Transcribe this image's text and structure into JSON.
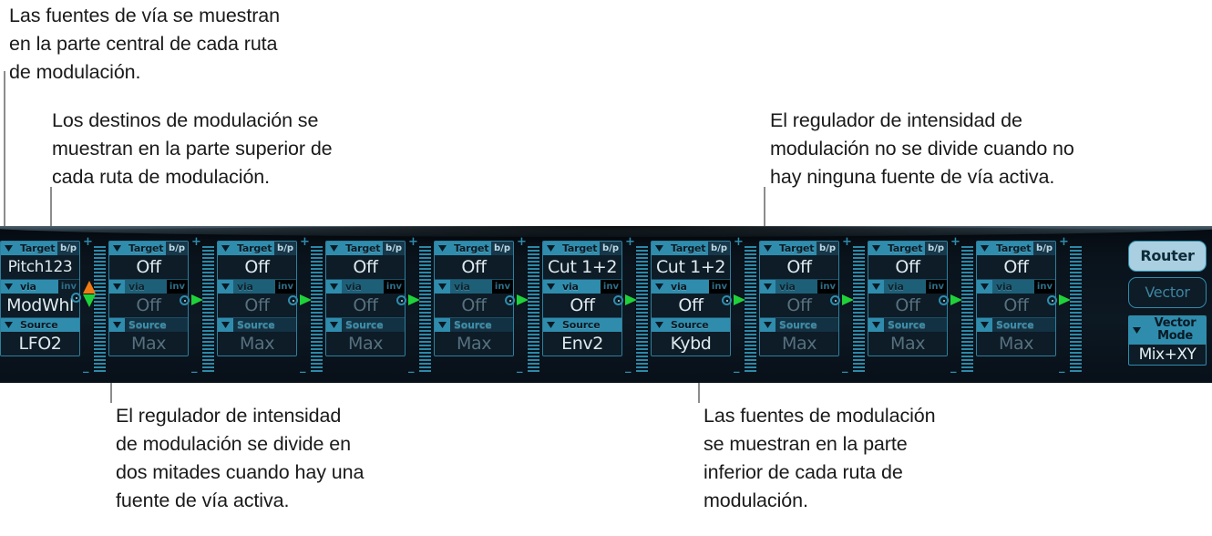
{
  "annotations": {
    "via_sources": "Las fuentes de vía se muestran\nen la parte central de cada ruta\nde modulación.",
    "targets": "Los destinos de modulación se\nmuestran en la parte superior de\ncada ruta de modulación.",
    "intensity_undivided": "El regulador de intensidad de\nmodulación no se divide cuando no\nhay ninguna fuente de vía activa.",
    "intensity_divided": "El regulador de intensidad\nde modulación se divide en\ndos mitades cuando hay una\nfuente de vía activa.",
    "mod_sources": "Las fuentes de modulación\nse muestran en la parte\ninferior de cada ruta de\nmodulación."
  },
  "panel": {
    "labels": {
      "target": "Target",
      "bp": "b/p",
      "via": "via",
      "inv": "inv",
      "source": "Source",
      "plus": "+",
      "minus": "_"
    },
    "routes": [
      {
        "target": "Pitch123",
        "target_active": true,
        "via": "ModWhl",
        "via_active": true,
        "source": "LFO2",
        "source_active": true,
        "slider_split": true,
        "inv_box": false
      },
      {
        "target": "Off",
        "target_active": true,
        "via": "Off",
        "via_active": false,
        "source": "Max",
        "source_active": false,
        "slider_split": false,
        "inv_box": true
      },
      {
        "target": "Off",
        "target_active": true,
        "via": "Off",
        "via_active": false,
        "source": "Max",
        "source_active": false,
        "slider_split": false,
        "inv_box": true
      },
      {
        "target": "Off",
        "target_active": true,
        "via": "Off",
        "via_active": false,
        "source": "Max",
        "source_active": false,
        "slider_split": false,
        "inv_box": true
      },
      {
        "target": "Off",
        "target_active": true,
        "via": "Off",
        "via_active": false,
        "source": "Max",
        "source_active": false,
        "slider_split": false,
        "inv_box": true
      },
      {
        "target": "Cut 1+2",
        "target_active": true,
        "via": "Off",
        "via_active": true,
        "source": "Env2",
        "source_active": true,
        "slider_split": false,
        "inv_box": true
      },
      {
        "target": "Cut 1+2",
        "target_active": true,
        "via": "Off",
        "via_active": true,
        "source": "Kybd",
        "source_active": true,
        "slider_split": false,
        "inv_box": true
      },
      {
        "target": "Off",
        "target_active": true,
        "via": "Off",
        "via_active": false,
        "source": "Max",
        "source_active": false,
        "slider_split": false,
        "inv_box": true
      },
      {
        "target": "Off",
        "target_active": true,
        "via": "Off",
        "via_active": false,
        "source": "Max",
        "source_active": false,
        "slider_split": false,
        "inv_box": true
      },
      {
        "target": "Off",
        "target_active": true,
        "via": "Off",
        "via_active": false,
        "source": "Max",
        "source_active": false,
        "slider_split": false,
        "inv_box": true
      }
    ],
    "sidebar": {
      "router_label": "Router",
      "router_selected": true,
      "vector_label": "Vector",
      "vector_selected": false,
      "vector_mode_label": "Vector\nMode",
      "vector_mode_value": "Mix+XY"
    }
  },
  "colors": {
    "accent_cyan": "#2f8cad",
    "panel_bg": "#0b1822",
    "knob_green": "#1fd23a",
    "knob_orange": "#f07b12",
    "button_active": "#a9cfe0",
    "text_light": "#dfe9ee",
    "text_dim": "#56707e",
    "leader_line": "#8c8c8c"
  }
}
